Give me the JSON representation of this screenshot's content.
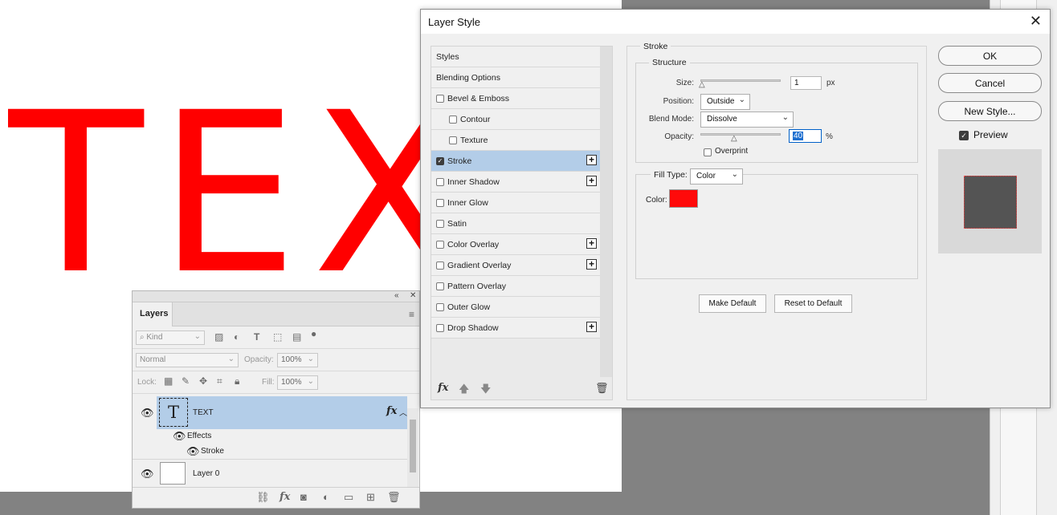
{
  "canvas": {
    "text": "TEXT"
  },
  "layers_panel": {
    "tab": "Layers",
    "kind_placeholder": "Kind",
    "blend_mode": "Normal",
    "opacity_label": "Opacity:",
    "opacity_value": "100%",
    "lock_label": "Lock:",
    "fill_label": "Fill:",
    "fill_value": "100%",
    "layers": [
      {
        "name": "TEXT",
        "effects_label": "Effects",
        "effect": "Stroke"
      },
      {
        "name": "Layer 0"
      }
    ]
  },
  "dialog": {
    "title": "Layer Style",
    "styles_header": "Styles",
    "blending_options": "Blending Options",
    "style_items": [
      {
        "label": "Bevel & Emboss",
        "checked": false,
        "plus": false
      },
      {
        "label": "Contour",
        "checked": false,
        "plus": false
      },
      {
        "label": "Texture",
        "checked": false,
        "plus": false
      },
      {
        "label": "Stroke",
        "checked": true,
        "plus": true
      },
      {
        "label": "Inner Shadow",
        "checked": false,
        "plus": true
      },
      {
        "label": "Inner Glow",
        "checked": false,
        "plus": false
      },
      {
        "label": "Satin",
        "checked": false,
        "plus": false
      },
      {
        "label": "Color Overlay",
        "checked": false,
        "plus": true
      },
      {
        "label": "Gradient Overlay",
        "checked": false,
        "plus": true
      },
      {
        "label": "Pattern Overlay",
        "checked": false,
        "plus": false
      },
      {
        "label": "Outer Glow",
        "checked": false,
        "plus": false
      },
      {
        "label": "Drop Shadow",
        "checked": false,
        "plus": true
      }
    ],
    "stroke": {
      "group_title": "Stroke",
      "structure_title": "Structure",
      "size_label": "Size:",
      "size_value": "1",
      "size_unit": "px",
      "size_level": 0.0,
      "position_label": "Position:",
      "position_value": "Outside",
      "blend_label": "Blend Mode:",
      "blend_value": "Dissolve",
      "opacity_label": "Opacity:",
      "opacity_value": "40",
      "opacity_unit": "%",
      "opacity_level": 0.4,
      "overprint_label": "Overprint",
      "fill_type_label": "Fill Type:",
      "fill_type_value": "Color",
      "color_label": "Color:",
      "color_hex": "#ff0a0a",
      "make_default": "Make Default",
      "reset_default": "Reset to Default"
    },
    "buttons": {
      "ok": "OK",
      "cancel": "Cancel",
      "new_style": "New Style..."
    },
    "preview_label": "Preview",
    "preview_checked": true
  }
}
